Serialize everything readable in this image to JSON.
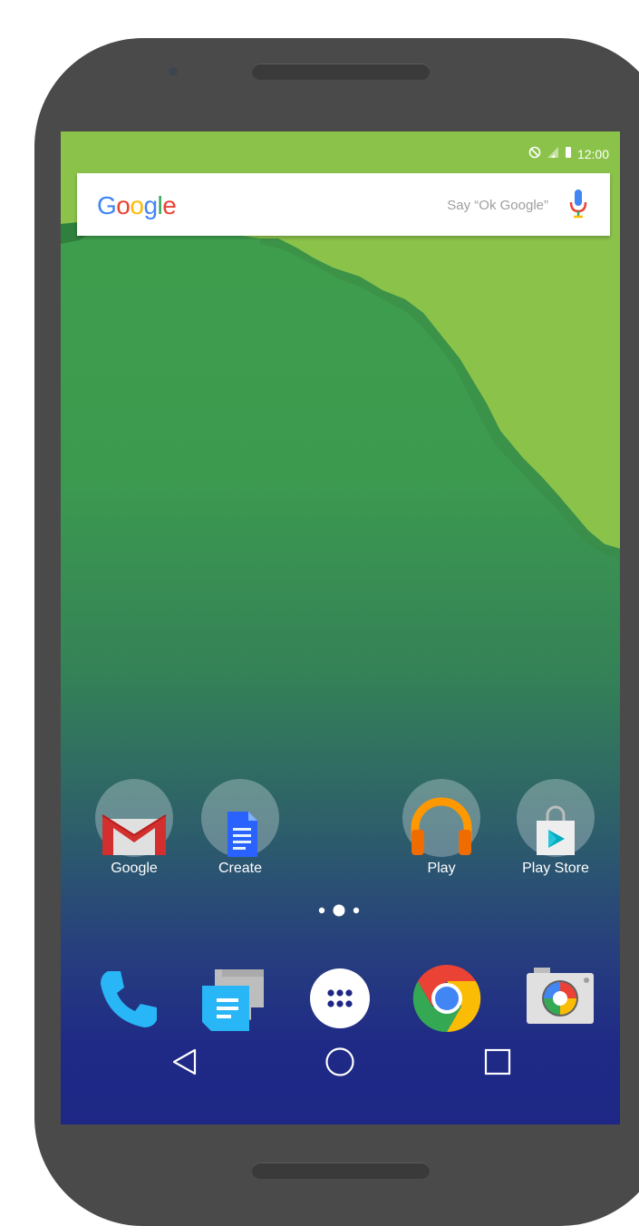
{
  "status_bar": {
    "time": "12:00"
  },
  "search": {
    "logo_text": "Google",
    "hint": "Say “Ok Google”",
    "mic_icon": "mic-icon"
  },
  "home_apps": [
    {
      "label": "Google",
      "icon": "gmail-icon"
    },
    {
      "label": "Create",
      "icon": "docs-icon"
    },
    {
      "label": "Play",
      "icon": "play-music-icon"
    },
    {
      "label": "Play Store",
      "icon": "play-store-icon"
    }
  ],
  "page_indicator": {
    "pages": 3,
    "current": 2
  },
  "dock": [
    {
      "icon": "phone-icon"
    },
    {
      "icon": "messenger-icon"
    },
    {
      "icon": "app-drawer-icon"
    },
    {
      "icon": "chrome-icon"
    },
    {
      "icon": "camera-icon"
    }
  ],
  "nav": [
    {
      "icon": "back-icon"
    },
    {
      "icon": "home-icon"
    },
    {
      "icon": "recents-icon"
    }
  ],
  "colors": {
    "wallpaper_light": "#8bc34a",
    "wallpaper_dark": "#3f9f4c",
    "nav_blue": "#1e2785"
  }
}
